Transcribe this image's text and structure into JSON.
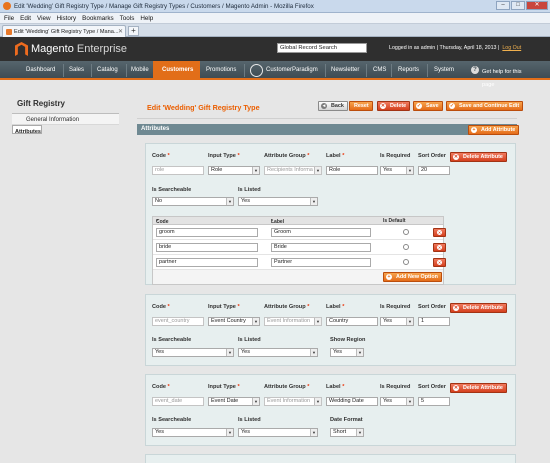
{
  "browser": {
    "window_title": "Edit 'Wedding' Gift Registry Type / Manage Gift Registry Types / Customers / Magento Admin - Mozilla Firefox",
    "menu": [
      "File",
      "Edit",
      "View",
      "History",
      "Bookmarks",
      "Tools",
      "Help"
    ],
    "tab_label": "Edit 'Wedding' Gift Registry Type / Mana...",
    "new_tab": "+"
  },
  "header": {
    "logo_main": "Magento",
    "logo_sub": "Enterprise",
    "search_value": "Global Record Search",
    "logged_in": "Logged in as admin | Thursday, April 18, 2013 |",
    "logout": "Log Out"
  },
  "nav": {
    "items": [
      "Dashboard",
      "Sales",
      "Catalog",
      "Mobile",
      "Customers",
      "Promotions",
      "CustomerParadigm",
      "Newsletter",
      "CMS",
      "Reports",
      "System"
    ],
    "active": "Customers",
    "help": "Get help for this page"
  },
  "sidebar": {
    "title": "Gift Registry",
    "items": [
      {
        "label": "General Information"
      },
      {
        "label": "Attributes"
      }
    ]
  },
  "page": {
    "title": "Edit 'Wedding' Gift Registry Type",
    "buttons": {
      "back": "Back",
      "reset": "Reset",
      "delete": "Delete",
      "save": "Save",
      "save_continue": "Save and Continue Edit"
    },
    "section_title": "Attributes",
    "add_attribute": "Add Attribute"
  },
  "labels": {
    "code": "Code",
    "input_type": "Input Type",
    "attribute_group": "Attribute Group",
    "label": "Label",
    "is_required": "Is Required",
    "sort_order": "Sort Order",
    "delete_attribute": "Delete Attribute",
    "is_searcheable": "Is Searcheable",
    "is_listed": "Is Listed",
    "show_region": "Show Region",
    "date_format": "Date Format",
    "opt_code": "Code",
    "opt_label": "Label",
    "opt_default": "Is Default",
    "add_new_option": "Add New Option"
  },
  "attributes": [
    {
      "code": "role",
      "input_type": "Role",
      "group": "Recipients Informa",
      "label": "Role",
      "required": "Yes",
      "sort": "20",
      "searcheable": "No",
      "listed": "Yes",
      "options": [
        {
          "code": "groom",
          "label": "Groom"
        },
        {
          "code": "bride",
          "label": "Bride"
        },
        {
          "code": "partner",
          "label": "Partner"
        }
      ]
    },
    {
      "code": "event_country",
      "input_type": "Event Country",
      "group": "Event Information",
      "label": "Country",
      "required": "Yes",
      "sort": "1",
      "searcheable": "Yes",
      "listed": "Yes",
      "extra": "Yes"
    },
    {
      "code": "event_date",
      "input_type": "Event Date",
      "group": "Event Information",
      "label": "Wedding Date",
      "required": "Yes",
      "sort": "5",
      "searcheable": "Yes",
      "listed": "Yes",
      "extra": "Short"
    }
  ]
}
